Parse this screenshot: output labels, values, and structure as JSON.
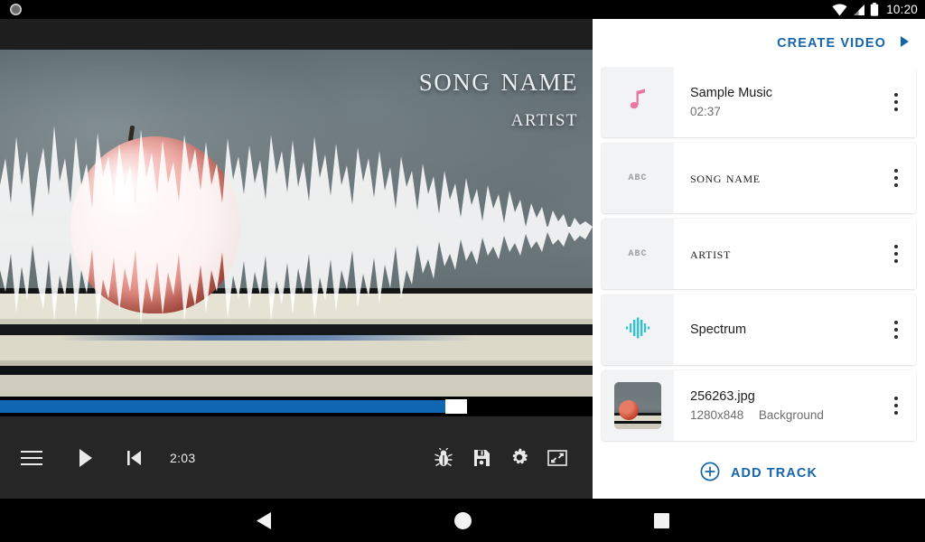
{
  "status_bar": {
    "recording_indicator": "record-dot",
    "wifi_icon": "wifi-icon",
    "signal_icon": "cellular-signal-icon",
    "battery_icon": "battery-icon",
    "time": "10:20"
  },
  "preview": {
    "song_title": "Song name",
    "artist": "Artist",
    "background_description": "apple-on-books-photo",
    "waveform_overlay": "audio-waveform-overlay"
  },
  "seek": {
    "progress_percent": 75,
    "fill_color": "#1068b3",
    "thumb_color": "#ffffff"
  },
  "toolbar": {
    "menu_icon": "hamburger-menu-icon",
    "play_icon": "play-icon",
    "skip_previous_icon": "skip-previous-icon",
    "time": "2:03",
    "bug_icon": "bug-icon",
    "save_icon": "save-floppy-icon",
    "settings_icon": "settings-gear-icon",
    "resize_icon": "aspect-ratio-icon"
  },
  "panel": {
    "create_video_label": "CREATE VIDEO",
    "create_video_arrow": "play-arrow-icon",
    "accent_color": "#1565a8",
    "add_track_label": "ADD TRACK",
    "add_track_icon": "plus-circle-icon",
    "kebab_icon": "more-vertical-icon",
    "tracks": [
      {
        "icon": "music-note-icon",
        "icon_color": "#e8789f",
        "icon_kind": "note",
        "title": "Sample Music",
        "title_style": "sans",
        "subtitle": "02:37",
        "subtitle_extra": ""
      },
      {
        "icon": "text-abc-icon",
        "icon_color": "#9b9fa4",
        "icon_kind": "abc",
        "icon_label": "ABC",
        "title": "Song name",
        "title_style": "serif",
        "subtitle": "",
        "subtitle_extra": ""
      },
      {
        "icon": "text-abc-icon",
        "icon_color": "#9b9fa4",
        "icon_kind": "abc",
        "icon_label": "ABC",
        "title": "Artist",
        "title_style": "serif",
        "subtitle": "",
        "subtitle_extra": ""
      },
      {
        "icon": "spectrum-icon",
        "icon_color": "#2ec4d4",
        "icon_kind": "spectrum",
        "title": "Spectrum",
        "title_style": "sans",
        "subtitle": "",
        "subtitle_extra": ""
      },
      {
        "icon": "image-thumbnail",
        "icon_color": "",
        "icon_kind": "image",
        "title": "256263.jpg",
        "title_style": "sans",
        "subtitle": "1280x848",
        "subtitle_extra": "Background"
      }
    ]
  },
  "nav_bar": {
    "back_icon": "back-triangle-icon",
    "home_icon": "home-circle-icon",
    "recents_icon": "recents-square-icon"
  }
}
